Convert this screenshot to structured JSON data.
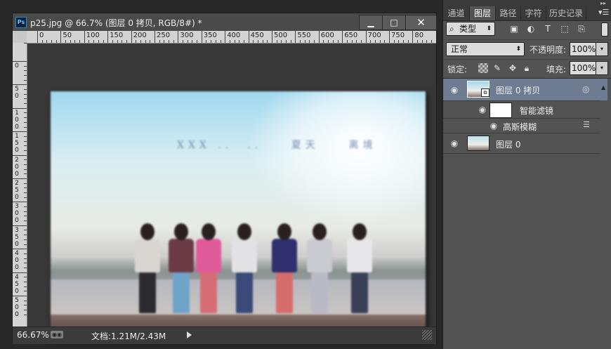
{
  "document": {
    "title": "p25.jpg @ 66.7% (图层 0 拷贝, RGB/8#) *",
    "app_icon": "Ps",
    "window_buttons": {
      "minimize": "▁",
      "maximize": "□",
      "close": "✕"
    },
    "photo_text": "XXX ..  ..    夏天    离境",
    "status": {
      "zoom": "66.67%",
      "doc_info": "文档:1.21M/2.43M"
    },
    "ruler_h_labels": [
      "0",
      "50",
      "100",
      "150",
      "200",
      "250",
      "300",
      "350",
      "400",
      "450",
      "500",
      "550",
      "600",
      "650",
      "700",
      "750",
      "80"
    ],
    "ruler_v_labels": [
      "0",
      "50",
      "100",
      "150",
      "200",
      "250",
      "300",
      "350",
      "400",
      "450",
      "500"
    ]
  },
  "panel": {
    "tabs": [
      "通道",
      "图层",
      "路径",
      "字符",
      "历史记录"
    ],
    "active_tab": "图层",
    "filter_kind": "类型",
    "filter_icons": [
      "image-filter-icon",
      "adjustment-filter-icon",
      "type-filter-icon",
      "shape-filter-icon",
      "smart-object-filter-icon"
    ],
    "blend_mode": "正常",
    "opacity_label": "不透明度:",
    "opacity_value": "100%",
    "lock_label": "锁定:",
    "fill_label": "填充:",
    "fill_value": "100%",
    "layers": {
      "copy_name": "图层 0 拷贝",
      "smart_filters_name": "智能滤镜",
      "gaussian_blur_name": "高斯模糊",
      "base_name": "图层 0"
    }
  },
  "colors": {
    "selected_layer": "#6e7c92",
    "panel_bg": "#535353",
    "app_bg": "#282828"
  }
}
